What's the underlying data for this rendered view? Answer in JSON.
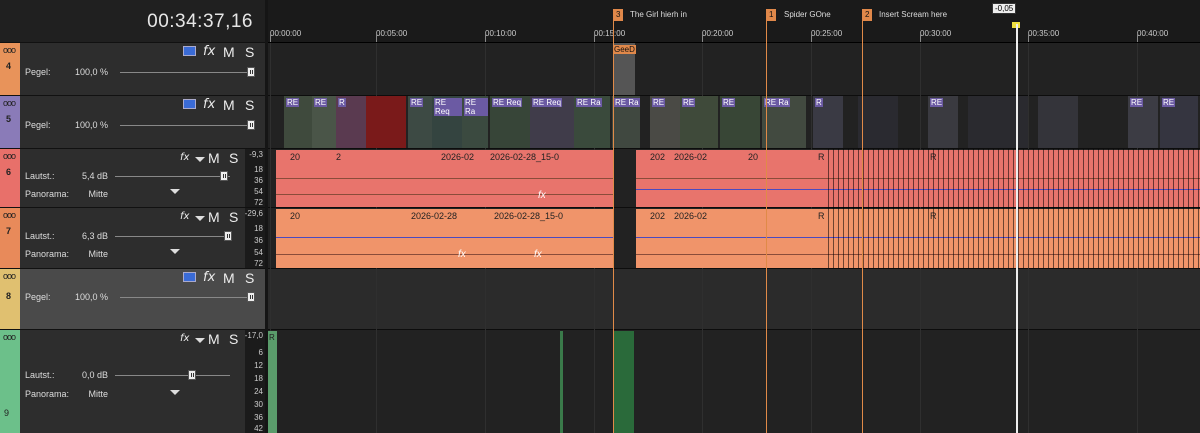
{
  "timecode": "00:34:37,16",
  "tracks": [
    {
      "num": "4",
      "label": "Pegel:",
      "value": "100,0 %",
      "color": "#e8935a"
    },
    {
      "num": "5",
      "label": "Pegel:",
      "value": "100,0 %",
      "color": "#8a7bb8"
    },
    {
      "num": "6",
      "label": "Lautst.:",
      "value": "5,4 dB",
      "label2": "Panorama:",
      "value2": "Mitte",
      "peak": "-9,3",
      "color": "#e8706a"
    },
    {
      "num": "7",
      "label": "Lautst.:",
      "value": "6,3 dB",
      "label2": "Panorama:",
      "value2": "Mitte",
      "peak": "-29,6",
      "color": "#e88a5a"
    },
    {
      "num": "8",
      "label": "Pegel:",
      "value": "100,0 %",
      "color": "#e0c070"
    },
    {
      "num": "9",
      "label": "Lautst.:",
      "value": "0,0 dB",
      "label2": "Panorama:",
      "value2": "Mitte",
      "peak": "-17,0",
      "color": "#6cc08a"
    }
  ],
  "meter_scale_a": [
    "18",
    "36",
    "54",
    "72"
  ],
  "meter_scale_b": [
    "6",
    "12",
    "18",
    "24",
    "30",
    "36",
    "42"
  ],
  "buttons": {
    "fx": "fx",
    "mute": "M",
    "solo": "S",
    "dots": "ooo"
  },
  "ruler": [
    "00:00:00",
    "00:05:00",
    "00:10:00",
    "00:15:00",
    "00:20:00",
    "00:25:00",
    "00:30:00",
    "00:35:00",
    "00:40:00"
  ],
  "markers": [
    {
      "num": "3",
      "text": "The Girl hierh in"
    },
    {
      "num": "1",
      "text": "Spider GOne"
    },
    {
      "num": "2",
      "text": "Insert Scream here"
    }
  ],
  "cursor_value": "-0,05",
  "clip_labels": {
    "gee": "GeeD",
    "re": "RE",
    "req": "RE Req",
    "ra": "RE Ra",
    "date1": "2026-02-28_15-0",
    "date2": "2026-02-28_15-0",
    "date_short": "2026-02",
    "date_mid": "2026-02-28",
    "n20": "20",
    "n2": "2",
    "n202": "202",
    "r": "R",
    "fx": "fx",
    "dots": "ooo"
  }
}
